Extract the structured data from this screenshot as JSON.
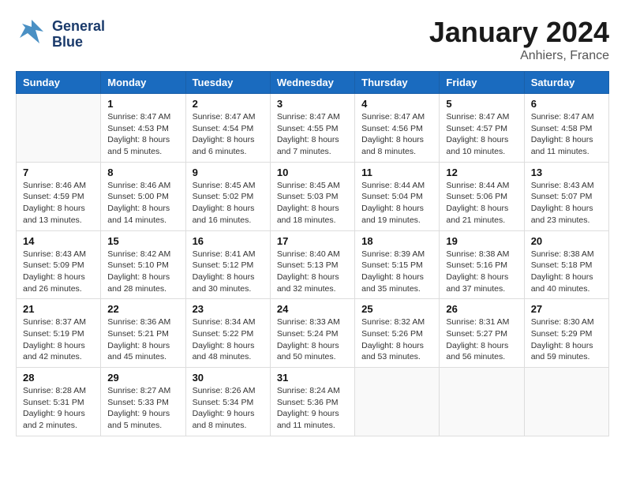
{
  "header": {
    "logo_line1": "General",
    "logo_line2": "Blue",
    "month": "January 2024",
    "location": "Anhiers, France"
  },
  "weekdays": [
    "Sunday",
    "Monday",
    "Tuesday",
    "Wednesday",
    "Thursday",
    "Friday",
    "Saturday"
  ],
  "weeks": [
    [
      {
        "day": "",
        "sunrise": "",
        "sunset": "",
        "daylight": ""
      },
      {
        "day": "1",
        "sunrise": "Sunrise: 8:47 AM",
        "sunset": "Sunset: 4:53 PM",
        "daylight": "Daylight: 8 hours and 5 minutes."
      },
      {
        "day": "2",
        "sunrise": "Sunrise: 8:47 AM",
        "sunset": "Sunset: 4:54 PM",
        "daylight": "Daylight: 8 hours and 6 minutes."
      },
      {
        "day": "3",
        "sunrise": "Sunrise: 8:47 AM",
        "sunset": "Sunset: 4:55 PM",
        "daylight": "Daylight: 8 hours and 7 minutes."
      },
      {
        "day": "4",
        "sunrise": "Sunrise: 8:47 AM",
        "sunset": "Sunset: 4:56 PM",
        "daylight": "Daylight: 8 hours and 8 minutes."
      },
      {
        "day": "5",
        "sunrise": "Sunrise: 8:47 AM",
        "sunset": "Sunset: 4:57 PM",
        "daylight": "Daylight: 8 hours and 10 minutes."
      },
      {
        "day": "6",
        "sunrise": "Sunrise: 8:47 AM",
        "sunset": "Sunset: 4:58 PM",
        "daylight": "Daylight: 8 hours and 11 minutes."
      }
    ],
    [
      {
        "day": "7",
        "sunrise": "Sunrise: 8:46 AM",
        "sunset": "Sunset: 4:59 PM",
        "daylight": "Daylight: 8 hours and 13 minutes."
      },
      {
        "day": "8",
        "sunrise": "Sunrise: 8:46 AM",
        "sunset": "Sunset: 5:00 PM",
        "daylight": "Daylight: 8 hours and 14 minutes."
      },
      {
        "day": "9",
        "sunrise": "Sunrise: 8:45 AM",
        "sunset": "Sunset: 5:02 PM",
        "daylight": "Daylight: 8 hours and 16 minutes."
      },
      {
        "day": "10",
        "sunrise": "Sunrise: 8:45 AM",
        "sunset": "Sunset: 5:03 PM",
        "daylight": "Daylight: 8 hours and 18 minutes."
      },
      {
        "day": "11",
        "sunrise": "Sunrise: 8:44 AM",
        "sunset": "Sunset: 5:04 PM",
        "daylight": "Daylight: 8 hours and 19 minutes."
      },
      {
        "day": "12",
        "sunrise": "Sunrise: 8:44 AM",
        "sunset": "Sunset: 5:06 PM",
        "daylight": "Daylight: 8 hours and 21 minutes."
      },
      {
        "day": "13",
        "sunrise": "Sunrise: 8:43 AM",
        "sunset": "Sunset: 5:07 PM",
        "daylight": "Daylight: 8 hours and 23 minutes."
      }
    ],
    [
      {
        "day": "14",
        "sunrise": "Sunrise: 8:43 AM",
        "sunset": "Sunset: 5:09 PM",
        "daylight": "Daylight: 8 hours and 26 minutes."
      },
      {
        "day": "15",
        "sunrise": "Sunrise: 8:42 AM",
        "sunset": "Sunset: 5:10 PM",
        "daylight": "Daylight: 8 hours and 28 minutes."
      },
      {
        "day": "16",
        "sunrise": "Sunrise: 8:41 AM",
        "sunset": "Sunset: 5:12 PM",
        "daylight": "Daylight: 8 hours and 30 minutes."
      },
      {
        "day": "17",
        "sunrise": "Sunrise: 8:40 AM",
        "sunset": "Sunset: 5:13 PM",
        "daylight": "Daylight: 8 hours and 32 minutes."
      },
      {
        "day": "18",
        "sunrise": "Sunrise: 8:39 AM",
        "sunset": "Sunset: 5:15 PM",
        "daylight": "Daylight: 8 hours and 35 minutes."
      },
      {
        "day": "19",
        "sunrise": "Sunrise: 8:38 AM",
        "sunset": "Sunset: 5:16 PM",
        "daylight": "Daylight: 8 hours and 37 minutes."
      },
      {
        "day": "20",
        "sunrise": "Sunrise: 8:38 AM",
        "sunset": "Sunset: 5:18 PM",
        "daylight": "Daylight: 8 hours and 40 minutes."
      }
    ],
    [
      {
        "day": "21",
        "sunrise": "Sunrise: 8:37 AM",
        "sunset": "Sunset: 5:19 PM",
        "daylight": "Daylight: 8 hours and 42 minutes."
      },
      {
        "day": "22",
        "sunrise": "Sunrise: 8:36 AM",
        "sunset": "Sunset: 5:21 PM",
        "daylight": "Daylight: 8 hours and 45 minutes."
      },
      {
        "day": "23",
        "sunrise": "Sunrise: 8:34 AM",
        "sunset": "Sunset: 5:22 PM",
        "daylight": "Daylight: 8 hours and 48 minutes."
      },
      {
        "day": "24",
        "sunrise": "Sunrise: 8:33 AM",
        "sunset": "Sunset: 5:24 PM",
        "daylight": "Daylight: 8 hours and 50 minutes."
      },
      {
        "day": "25",
        "sunrise": "Sunrise: 8:32 AM",
        "sunset": "Sunset: 5:26 PM",
        "daylight": "Daylight: 8 hours and 53 minutes."
      },
      {
        "day": "26",
        "sunrise": "Sunrise: 8:31 AM",
        "sunset": "Sunset: 5:27 PM",
        "daylight": "Daylight: 8 hours and 56 minutes."
      },
      {
        "day": "27",
        "sunrise": "Sunrise: 8:30 AM",
        "sunset": "Sunset: 5:29 PM",
        "daylight": "Daylight: 8 hours and 59 minutes."
      }
    ],
    [
      {
        "day": "28",
        "sunrise": "Sunrise: 8:28 AM",
        "sunset": "Sunset: 5:31 PM",
        "daylight": "Daylight: 9 hours and 2 minutes."
      },
      {
        "day": "29",
        "sunrise": "Sunrise: 8:27 AM",
        "sunset": "Sunset: 5:33 PM",
        "daylight": "Daylight: 9 hours and 5 minutes."
      },
      {
        "day": "30",
        "sunrise": "Sunrise: 8:26 AM",
        "sunset": "Sunset: 5:34 PM",
        "daylight": "Daylight: 9 hours and 8 minutes."
      },
      {
        "day": "31",
        "sunrise": "Sunrise: 8:24 AM",
        "sunset": "Sunset: 5:36 PM",
        "daylight": "Daylight: 9 hours and 11 minutes."
      },
      {
        "day": "",
        "sunrise": "",
        "sunset": "",
        "daylight": ""
      },
      {
        "day": "",
        "sunrise": "",
        "sunset": "",
        "daylight": ""
      },
      {
        "day": "",
        "sunrise": "",
        "sunset": "",
        "daylight": ""
      }
    ]
  ]
}
